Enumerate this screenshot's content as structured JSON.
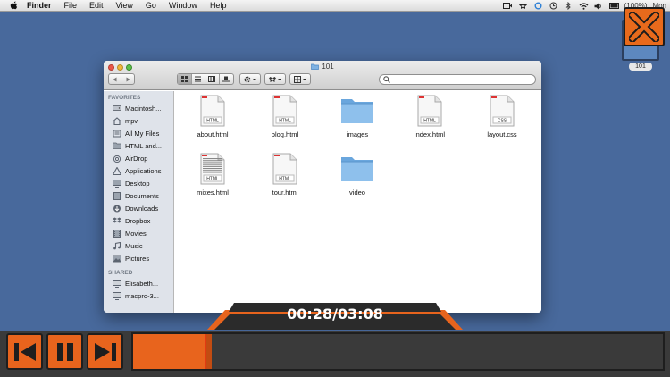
{
  "menubar": {
    "app": "Finder",
    "items": [
      "File",
      "Edit",
      "View",
      "Go",
      "Window",
      "Help"
    ],
    "battery": "(100%)",
    "clock": "Mon"
  },
  "desktop": {
    "icon_label": "101"
  },
  "window": {
    "title": "101",
    "sidebar": {
      "favorites_header": "FAVORITES",
      "favorites": [
        {
          "label": "Macintosh...",
          "icon": "hard-drive-icon"
        },
        {
          "label": "mpv",
          "icon": "home-icon"
        },
        {
          "label": "All My Files",
          "icon": "all-files-icon"
        },
        {
          "label": "HTML and...",
          "icon": "folder-icon"
        },
        {
          "label": "AirDrop",
          "icon": "airdrop-icon"
        },
        {
          "label": "Applications",
          "icon": "applications-icon"
        },
        {
          "label": "Desktop",
          "icon": "desktop-icon"
        },
        {
          "label": "Documents",
          "icon": "documents-icon"
        },
        {
          "label": "Downloads",
          "icon": "downloads-icon"
        },
        {
          "label": "Dropbox",
          "icon": "dropbox-icon"
        },
        {
          "label": "Movies",
          "icon": "movies-icon"
        },
        {
          "label": "Music",
          "icon": "music-icon"
        },
        {
          "label": "Pictures",
          "icon": "pictures-icon"
        }
      ],
      "shared_header": "SHARED",
      "shared": [
        {
          "label": "Elisabeth...",
          "icon": "computer-icon"
        },
        {
          "label": "macpro-3...",
          "icon": "computer-icon"
        }
      ]
    },
    "files": [
      {
        "name": "about.html",
        "kind": "html"
      },
      {
        "name": "blog.html",
        "kind": "html"
      },
      {
        "name": "images",
        "kind": "folder"
      },
      {
        "name": "index.html",
        "kind": "html"
      },
      {
        "name": "layout.css",
        "kind": "css"
      },
      {
        "name": "mixes.html",
        "kind": "html"
      },
      {
        "name": "tour.html",
        "kind": "html"
      },
      {
        "name": "video",
        "kind": "folder"
      }
    ],
    "html_badge": "HTML",
    "css_badge": "CSS"
  },
  "player": {
    "time": "00:28/03:08",
    "progress_fraction": 0.149,
    "accent": "#e8641d"
  }
}
